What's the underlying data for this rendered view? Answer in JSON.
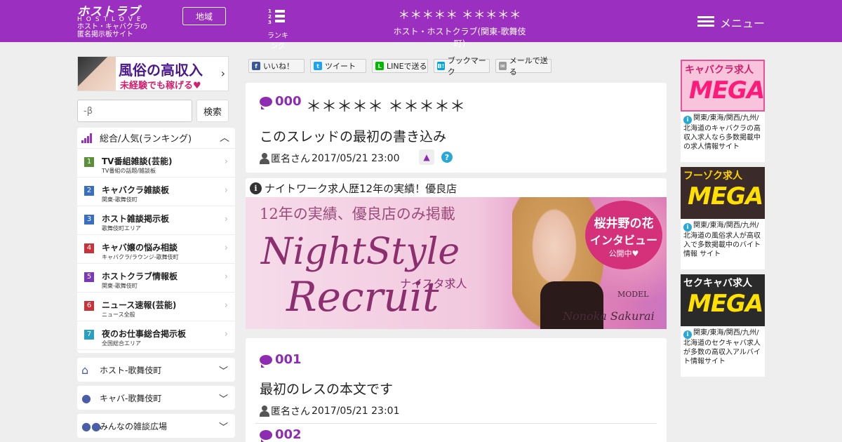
{
  "header": {
    "logo_main": "ホストラブ",
    "logo_sub": "HOSTLOVE",
    "logo_tag1": "ホスト・キャバクラの",
    "logo_tag2": "匿名掲示板サイト",
    "area_button": "地域",
    "ranking_label": "ランキング",
    "ranking_nums": [
      "1",
      "2",
      "3"
    ],
    "title": "＊＊＊＊＊ ＊＊＊＊＊",
    "subtitle": "ホスト・ホストクラブ(関東-歌舞伎町)",
    "menu_label": "メニュー"
  },
  "sidebar": {
    "banner_main": "風俗の高収入",
    "banner_sub": "未経験でも稼げる♥",
    "search_placeholder": "-β",
    "search_button": "検索",
    "ranking_title": "総合/人気(ランキング)",
    "ranking_items": [
      {
        "num": "1",
        "title": "TV番組雑談(芸能)",
        "sub": "TV番組の話題/雑談板",
        "color": "#5b8f3a"
      },
      {
        "num": "2",
        "title": "キャバクラ雑談板",
        "sub": "関東-歌舞伎町",
        "color": "#3a6fc0"
      },
      {
        "num": "3",
        "title": "ホスト雑談掲示板",
        "sub": "歌舞伎町エリア",
        "color": "#3a6fc0"
      },
      {
        "num": "4",
        "title": "キャバ嬢の悩み相談",
        "sub": "キャバクラ/ラウンジ-歌舞伎町",
        "color": "#c8323a"
      },
      {
        "num": "5",
        "title": "ホストクラブ情報板",
        "sub": "関東-歌舞伎町",
        "color": "#7a3ab8"
      },
      {
        "num": "6",
        "title": "ニュース速報(芸能)",
        "sub": "ニュース全般",
        "color": "#c8323a"
      },
      {
        "num": "7",
        "title": "夜のお仕事総合掲示板",
        "sub": "全国総合エリア",
        "color": "#2aa0c0"
      }
    ],
    "accordions": [
      {
        "label": "ホスト-歌舞伎町",
        "icon": "home-icon"
      },
      {
        "label": "キャバ-歌舞伎町",
        "icon": "user-icon"
      },
      {
        "label": "みんなの雑談広場",
        "icon": "users-icon"
      }
    ]
  },
  "social": [
    {
      "label": "いいね！",
      "icon": "facebook-icon",
      "color": "#3b5998",
      "glyph": "f"
    },
    {
      "label": "ツイート",
      "icon": "twitter-icon",
      "color": "#1da1f2",
      "glyph": "t"
    },
    {
      "label": "LINEで送る",
      "icon": "line-icon",
      "color": "#00b900",
      "glyph": "L"
    },
    {
      "label": "ブックマーク",
      "icon": "hatena-icon",
      "color": "#00a4de",
      "glyph": "B!"
    },
    {
      "label": "メールで送る",
      "icon": "mail-icon",
      "color": "#999999",
      "glyph": "✉"
    }
  ],
  "thread": {
    "num": "000",
    "title": "＊＊＊＊＊ ＊＊＊＊＊",
    "body": "このスレッドの最初の書き込み",
    "author": "匿名さん",
    "date": "2017/05/21 23:00"
  },
  "ad": {
    "heading": "ナイトワーク求人歴12年の実績！優良店",
    "top": "12年の実績、優良店のみ掲載",
    "brand": "NightStyle",
    "recruit": "Recruit",
    "brand_jp": "ナイスタ求人",
    "circle1": "桜井野の花",
    "circle2": "インタビュー",
    "circle3": "公開中♥",
    "model_label": "MODEL",
    "model_name": "Nonoka Sakurai"
  },
  "posts": [
    {
      "num": "001",
      "body": "最初のレスの本文です",
      "author": "匿名さん",
      "date": "2017/05/21 23:01"
    },
    {
      "num": "002"
    }
  ],
  "right_ads": [
    {
      "t1": "キャバクラ求人",
      "t2": "MEGA",
      "bg": "#f7c4dc",
      "text": "関東/東海/関西/九州/北海道のキャバクラの高収入求人なら多数掲載中の求人情報サイト"
    },
    {
      "t1": "フーゾク求人",
      "t2": "MEGA",
      "bg": "#3a2a2a",
      "text": "関東/東海/関西/九州/北海道の風俗求人が高収入で多数掲載中のバイト情報 サイト"
    },
    {
      "t1": "セクキャバ求人",
      "t2": "MEGA",
      "bg": "#2a2a2a",
      "text": "関東/東海/関西/九州/北海道のセクキャバ求人が多数の高収入アルバイト情報サイト"
    }
  ]
}
